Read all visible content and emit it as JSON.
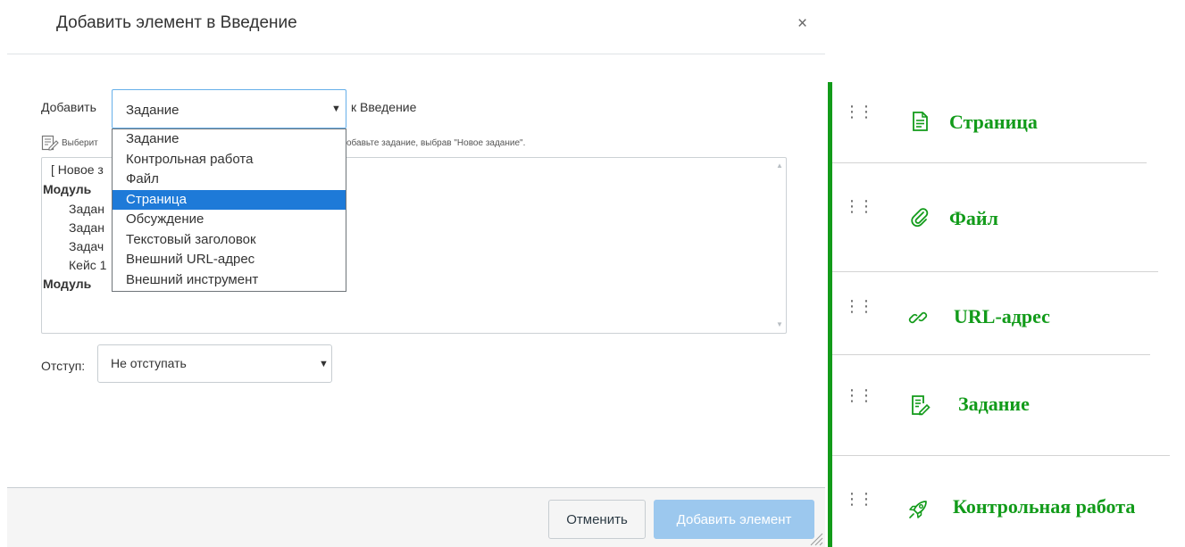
{
  "dialog": {
    "title": "Добавить элемент в Введение",
    "close_glyph": "×",
    "add_label": "Добавить",
    "item_type": "Задание",
    "to_label": "к Введение",
    "hint_left": "Выберит",
    "hint_right": "обавьте задание, выбрав \"Новое задание\".",
    "list_rows": [
      {
        "text": "[ Новое з",
        "bold": false
      },
      {
        "text": "Модуль",
        "bold": true
      },
      {
        "text": "Задан",
        "bold": false
      },
      {
        "text": "Задан",
        "bold": false
      },
      {
        "text": "Задач",
        "bold": false
      },
      {
        "text": "Кейс 1",
        "bold": false
      },
      {
        "text": "Модуль",
        "bold": true
      }
    ],
    "dropdown_options": [
      "Задание",
      "Контрольная работа",
      "Файл",
      "Страница",
      "Обсуждение",
      "Текстовый заголовок",
      "Внешний URL-адрес",
      "Внешний инструмент"
    ],
    "dropdown_highlighted": "Страница",
    "indent_label": "Отступ:",
    "indent_value": "Не отступать",
    "cancel_label": "Отменить",
    "submit_label": "Добавить элемент"
  },
  "legend": {
    "accent_color": "#129b1a",
    "items": [
      {
        "label": "Страница",
        "icon": "page-icon"
      },
      {
        "label": "Файл",
        "icon": "paperclip-icon"
      },
      {
        "label": "URL-адрес",
        "icon": "link-icon"
      },
      {
        "label": "Задание",
        "icon": "assignment-icon"
      },
      {
        "label": "Контрольная работа",
        "icon": "rocket-icon"
      }
    ]
  }
}
